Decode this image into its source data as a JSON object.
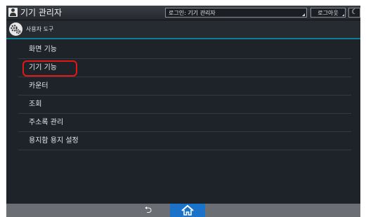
{
  "topbar": {
    "title": "기기 관리자",
    "login_status": "로그인: 기기 관리자",
    "logout_label": "로그아웃",
    "sleep_icon": "☾"
  },
  "header": {
    "section_title": "사용자 도구"
  },
  "menu": {
    "items": [
      {
        "label": "화면 기능",
        "selected": false
      },
      {
        "label": "기기 기능",
        "selected": true
      },
      {
        "label": "카운터",
        "selected": false
      },
      {
        "label": "조회",
        "selected": false
      },
      {
        "label": "주소록 관리",
        "selected": false
      },
      {
        "label": "용지함 용지 설정",
        "selected": false
      }
    ]
  },
  "bottombar": {
    "back_icon": "⮌"
  },
  "colors": {
    "accent_line": "#0c7d95",
    "highlight": "#e01818",
    "home_active": "#1a72c9"
  },
  "icons": [
    "user-icon",
    "gear-icon",
    "moon-icon",
    "back-icon",
    "home-icon"
  ]
}
